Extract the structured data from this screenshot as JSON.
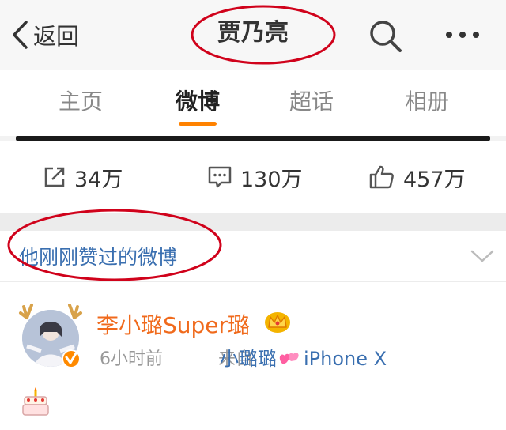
{
  "header": {
    "back_label": "返回",
    "title": "贾乃亮",
    "icons": [
      "chevron-left-icon",
      "search-icon",
      "more-icon"
    ]
  },
  "tabs": [
    {
      "label": "主页",
      "active": false
    },
    {
      "label": "微博",
      "active": true
    },
    {
      "label": "超话",
      "active": false
    },
    {
      "label": "相册",
      "active": false
    }
  ],
  "accent_color": "#ff8200",
  "annotation_color": "#d0021b",
  "stats": {
    "reposts": "34万",
    "comments": "130万",
    "likes": "457万"
  },
  "section": {
    "label": "他刚刚赞过的微博"
  },
  "post": {
    "username": "李小璐Super璐",
    "time": "6小时前",
    "source_prefix": "来自",
    "source_name": "小璐璐",
    "source_device": "iPhone X",
    "username_color": "#f06a1c"
  }
}
